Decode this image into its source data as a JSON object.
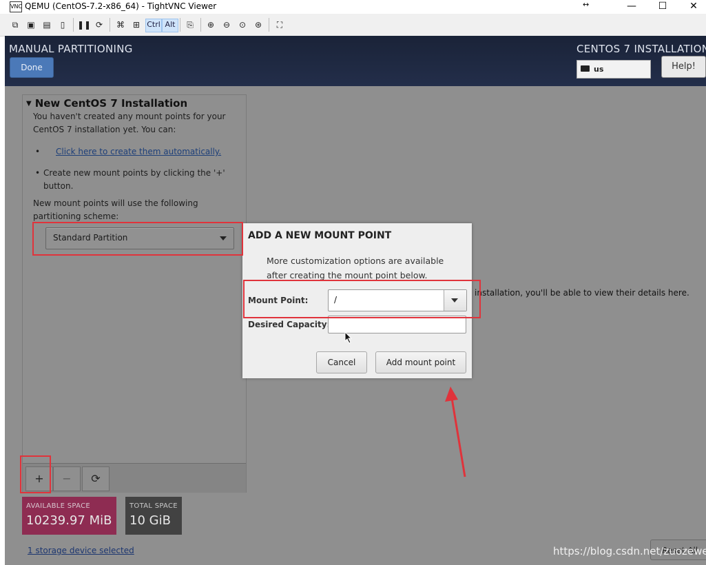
{
  "window": {
    "title": "QEMU (CentOS-7.2-x86_64) - TightVNC Viewer",
    "app_icon": "VNC",
    "resize_glyph": "↔",
    "minimize": "—",
    "maximize": "☐",
    "close": "✕"
  },
  "toolbar": {
    "ctrl_label": "Ctrl",
    "alt_label": "Alt"
  },
  "header": {
    "title": "MANUAL PARTITIONING",
    "done_label": "Done",
    "install_title": "CENTOS 7 INSTALLATION",
    "keyboard_layout": "us",
    "help_label": "Help!"
  },
  "left_panel": {
    "section_title": "New CentOS 7 Installation",
    "intro": "You haven't created any mount points for your CentOS 7 installation yet.  You can:",
    "auto_link": "Click here to create them automatically.",
    "manual_hint": "Create new mount points by clicking the '+' button.",
    "scheme_hint": "New mount points will use the following partitioning scheme:",
    "scheme_value": "Standard Partition",
    "add_label": "+",
    "remove_label": "−",
    "refresh_label": "⟳"
  },
  "space": {
    "available_label": "AVAILABLE SPACE",
    "available_value": "10239.97 MiB",
    "total_label": "TOTAL SPACE",
    "total_value": "10 GiB"
  },
  "storage_link": "1 storage device selected",
  "details_text": "installation, you'll be able to view their details here.",
  "reset_label": "Reset All",
  "watermark": "https://blog.csdn.net/zuozewei",
  "dialog": {
    "title": "ADD A NEW MOUNT POINT",
    "description": "More customization options are available after creating the mount point below.",
    "mount_point_label": "Mount Point:",
    "mount_point_value": "/",
    "capacity_label": "Desired Capacity:",
    "capacity_value": "",
    "cancel_label": "Cancel",
    "add_label": "Add mount point"
  },
  "colors": {
    "annotation": "#e0333b",
    "available_space_bg": "#8e2c52",
    "header_bg": "#1f2940",
    "done_button": "#4b79b8"
  }
}
